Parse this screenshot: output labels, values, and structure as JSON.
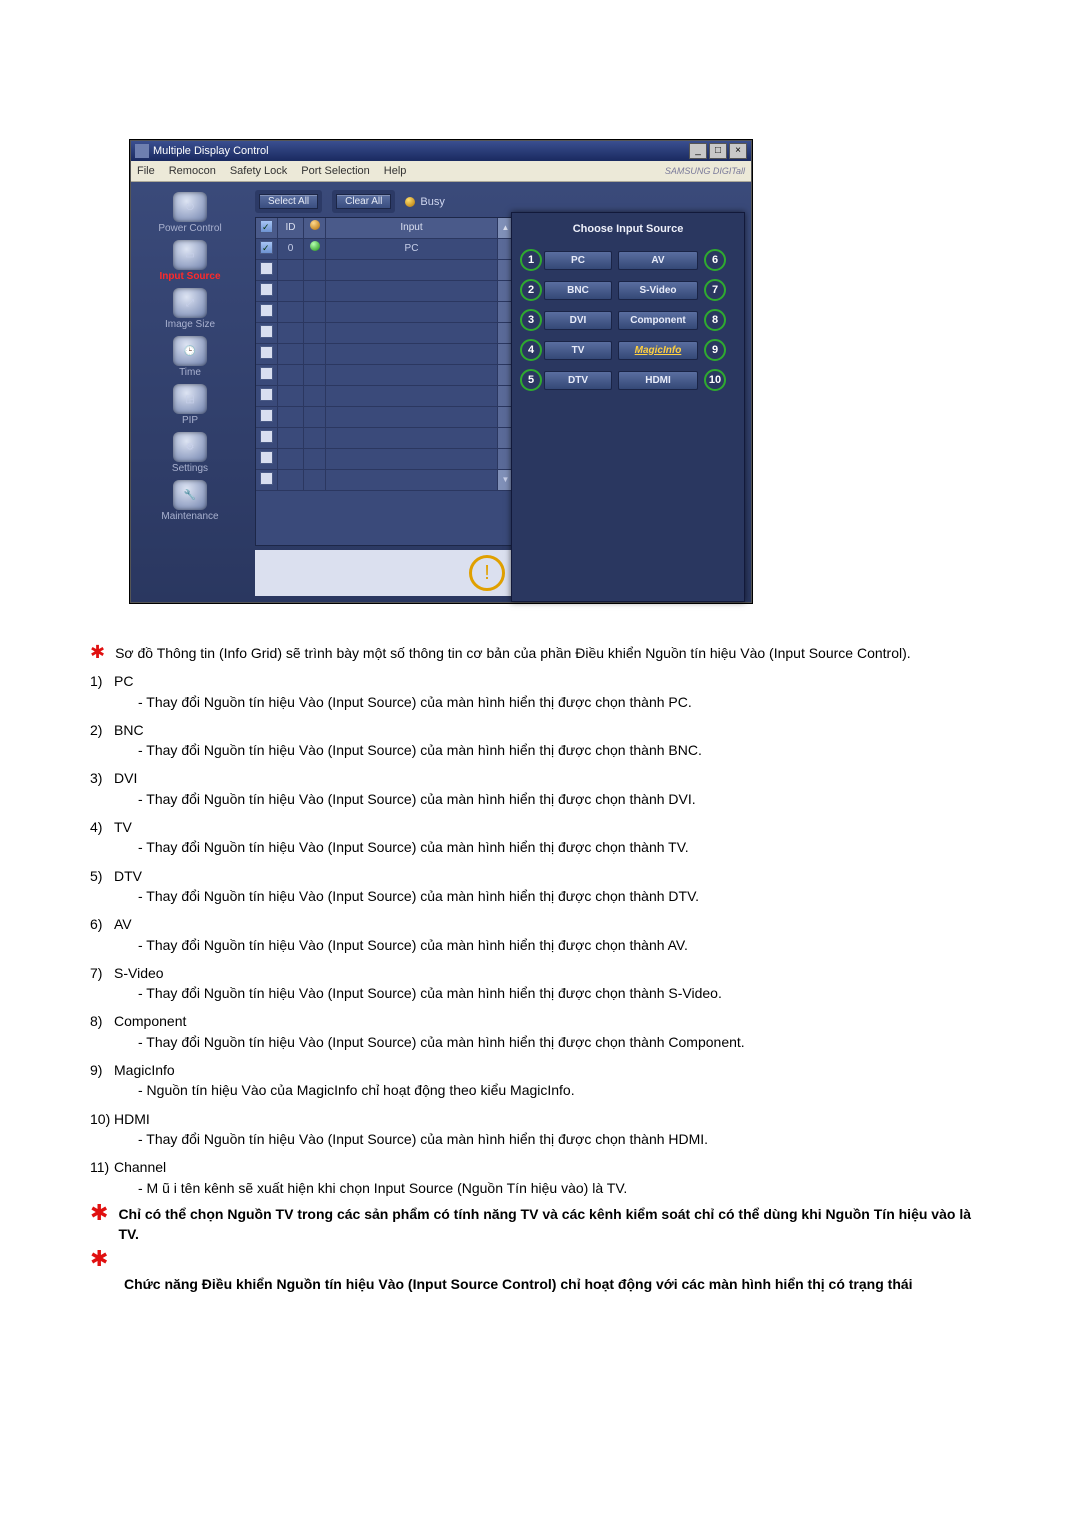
{
  "window": {
    "title": "Multiple Display Control",
    "buttons": {
      "min": "_",
      "max": "□",
      "close": "×"
    }
  },
  "menu": [
    "File",
    "Remocon",
    "Safety Lock",
    "Port Selection",
    "Help"
  ],
  "brand": "SAMSUNG DIGITall",
  "sidebar": [
    {
      "label": "Power Control",
      "active": false
    },
    {
      "label": "Input Source",
      "active": true
    },
    {
      "label": "Image Size",
      "active": false
    },
    {
      "label": "Time",
      "active": false
    },
    {
      "label": "PIP",
      "active": false
    },
    {
      "label": "Settings",
      "active": false
    },
    {
      "label": "Maintenance",
      "active": false
    }
  ],
  "toolbar": {
    "select_all": "Select All",
    "clear_all": "Clear All",
    "busy": "Busy"
  },
  "grid": {
    "cols": {
      "id": "ID",
      "input": "Input"
    },
    "rows": [
      {
        "checked": true,
        "id": "0",
        "status": "green",
        "input": "PC"
      },
      {
        "checked": false,
        "id": "",
        "status": "",
        "input": ""
      },
      {
        "checked": false,
        "id": "",
        "status": "",
        "input": ""
      },
      {
        "checked": false,
        "id": "",
        "status": "",
        "input": ""
      },
      {
        "checked": false,
        "id": "",
        "status": "",
        "input": ""
      },
      {
        "checked": false,
        "id": "",
        "status": "",
        "input": ""
      },
      {
        "checked": false,
        "id": "",
        "status": "",
        "input": ""
      },
      {
        "checked": false,
        "id": "",
        "status": "",
        "input": ""
      },
      {
        "checked": false,
        "id": "",
        "status": "",
        "input": ""
      },
      {
        "checked": false,
        "id": "",
        "status": "",
        "input": ""
      },
      {
        "checked": false,
        "id": "",
        "status": "",
        "input": ""
      },
      {
        "checked": false,
        "id": "",
        "status": "",
        "input": ""
      }
    ]
  },
  "popup": {
    "title": "Choose Input Source",
    "left": [
      "PC",
      "BNC",
      "DVI",
      "TV",
      "DTV"
    ],
    "right": [
      "AV",
      "S-Video",
      "Component",
      "MagicInfo",
      "HDMI"
    ],
    "left_nums": [
      "1",
      "2",
      "3",
      "4",
      "5"
    ],
    "right_nums": [
      "6",
      "7",
      "8",
      "9",
      "10"
    ]
  },
  "doc": {
    "intro": "Sơ đồ Thông tin (Info Grid) sẽ trình bày một số thông tin cơ bản của phần Điều khiển Nguồn tín hiệu Vào (Input Source Control).",
    "items": [
      {
        "num": "1)",
        "title": "PC",
        "desc": "- Thay đổi Nguồn tín hiệu Vào (Input Source) của màn hình hiển thị được chọn thành PC."
      },
      {
        "num": "2)",
        "title": "BNC",
        "desc": "- Thay đổi Nguồn tín hiệu Vào (Input Source) của màn hình hiển thị được chọn thành BNC."
      },
      {
        "num": "3)",
        "title": "DVI",
        "desc": "- Thay đổi Nguồn tín hiệu Vào (Input Source) của màn hình hiển thị được chọn thành DVI."
      },
      {
        "num": "4)",
        "title": "TV",
        "desc": "- Thay đổi Nguồn tín hiệu Vào (Input Source) của màn hình hiển thị được chọn thành TV."
      },
      {
        "num": "5)",
        "title": "DTV",
        "desc": "- Thay đổi Nguồn tín hiệu Vào (Input Source) của màn hình hiển thị được chọn thành DTV."
      },
      {
        "num": "6)",
        "title": "AV",
        "desc": "- Thay đổi Nguồn tín hiệu Vào (Input Source) của màn hình hiển thị được chọn thành AV."
      },
      {
        "num": "7)",
        "title": "S-Video",
        "desc": "- Thay đổi Nguồn tín hiệu Vào (Input Source) của màn hình hiển thị được chọn thành S-Video."
      },
      {
        "num": "8)",
        "title": "Component",
        "desc": "- Thay đổi Nguồn tín hiệu Vào (Input Source) của màn hình hiển thị được chọn thành Component."
      },
      {
        "num": "9)",
        "title": "MagicInfo",
        "desc": "- Nguồn tín hiệu Vào của MagicInfo chỉ hoạt động theo kiểu MagicInfo."
      },
      {
        "num": "10)",
        "title": "HDMI",
        "desc": "- Thay đổi Nguồn tín hiệu Vào (Input Source) của màn hình hiển thị được chọn thành HDMI."
      },
      {
        "num": "11)",
        "title": "Channel",
        "desc": "- M ũ i tên kênh sẽ xuất hiện khi chọn Input Source (Nguồn Tín hiệu vào) là TV."
      }
    ],
    "warn1": "Chỉ có thể chọn Nguồn TV trong các sản phẩm có tính năng TV và các kênh kiểm soát chỉ có thể dùng khi Nguồn Tín hiệu vào là TV.",
    "warn2": "Chức năng Điều khiển Nguồn tín hiệu Vào (Input Source Control) chỉ hoạt động với các màn hình hiển thị có trạng thái"
  }
}
